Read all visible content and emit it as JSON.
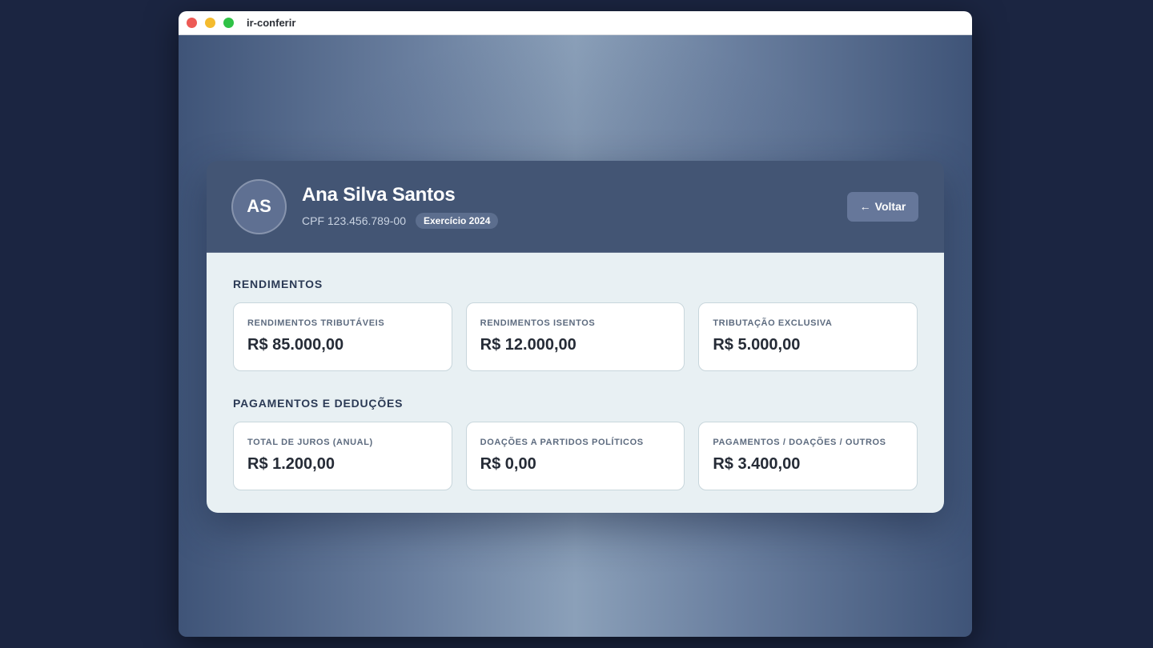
{
  "window": {
    "title": "ir-conferir"
  },
  "profile": {
    "initials": "AS",
    "name": "Ana Silva Santos",
    "cpf": "CPF 123.456.789-00",
    "exercise_badge": "Exercício 2024",
    "back_arrow": "←",
    "back_label": "Voltar"
  },
  "sections": [
    {
      "title": "RENDIMENTOS",
      "tiles": [
        {
          "label": "RENDIMENTOS TRIBUTÁVEIS",
          "value": "R$ 85.000,00"
        },
        {
          "label": "RENDIMENTOS ISENTOS",
          "value": "R$ 12.000,00"
        },
        {
          "label": "TRIBUTAÇÃO EXCLUSIVA",
          "value": "R$ 5.000,00"
        }
      ]
    },
    {
      "title": "PAGAMENTOS E DEDUÇÕES",
      "tiles": [
        {
          "label": "TOTAL DE JUROS (ANUAL)",
          "value": "R$ 1.200,00"
        },
        {
          "label": "DOAÇÕES A PARTIDOS POLÍTICOS",
          "value": "R$ 0,00"
        },
        {
          "label": "PAGAMENTOS / DOAÇÕES / OUTROS",
          "value": "R$ 3.400,00"
        }
      ]
    }
  ],
  "colors": {
    "header_bg": "#435574",
    "body_bg": "#e8f0f3",
    "traffic_red": "#ed5a55",
    "traffic_yellow": "#f4bb2e",
    "traffic_green": "#2fc246"
  }
}
